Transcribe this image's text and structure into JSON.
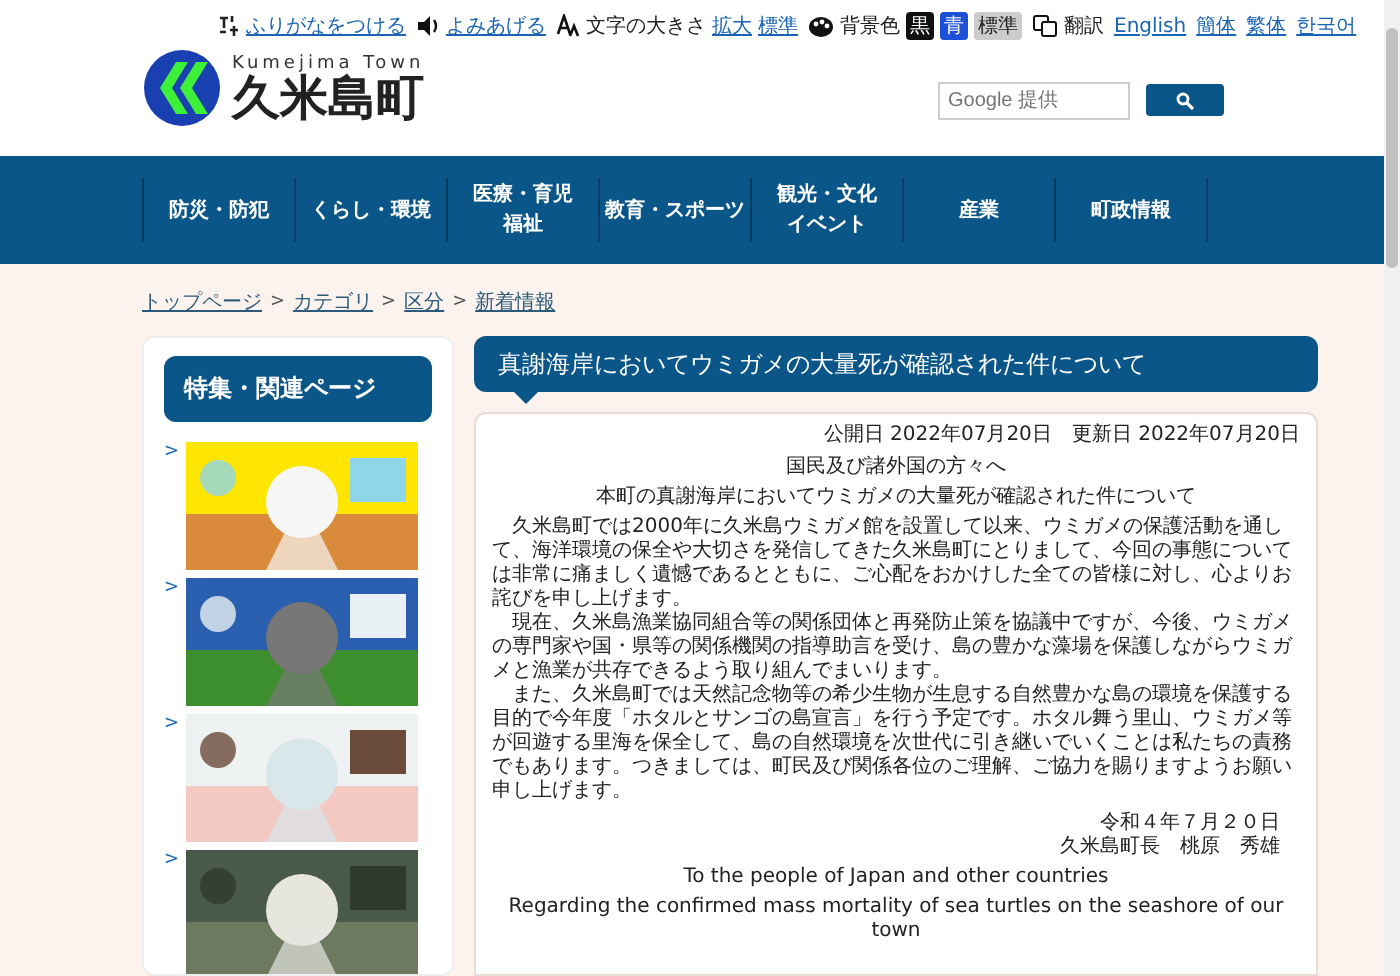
{
  "utility_bar": {
    "furigana": "ふりがなをつける",
    "read_aloud": "よみあげる",
    "text_size": {
      "label": "文字の大きさ",
      "links": [
        "拡大",
        "標準"
      ]
    },
    "background": {
      "label": "背景色",
      "options": [
        {
          "label": "黒",
          "kind": "black"
        },
        {
          "label": "青",
          "kind": "blue"
        },
        {
          "label": "標準",
          "kind": "standard"
        }
      ]
    },
    "translate": {
      "label": "翻訳",
      "links": [
        "English",
        "簡体",
        "繁体",
        "한국어"
      ]
    }
  },
  "logo": {
    "subtitle": "Kumejima Town",
    "title": "久米島町"
  },
  "search": {
    "placeholder": "Google 提供"
  },
  "nav": [
    {
      "lines": [
        "防災・防犯"
      ]
    },
    {
      "lines": [
        "くらし・環境"
      ]
    },
    {
      "lines": [
        "医療・育児",
        "福祉"
      ]
    },
    {
      "lines": [
        "教育・スポーツ"
      ]
    },
    {
      "lines": [
        "観光・文化",
        "イベント"
      ]
    },
    {
      "lines": [
        "産業"
      ]
    },
    {
      "lines": [
        "町政情報"
      ]
    }
  ],
  "breadcrumb": {
    "separator": ">",
    "items": [
      "トップページ",
      "カテゴリ",
      "区分",
      "新着情報"
    ]
  },
  "sidebar": {
    "title": "特集・関連ページ",
    "marker": ">"
  },
  "article": {
    "title": "真謝海岸においてウミガメの大量死が確認された件について",
    "dates": "公開日 2022年07月20日　更新日 2022年07月20日",
    "addressee": "国民及び諸外国の方々へ",
    "subject": "本町の真謝海岸においてウミガメの大量死が確認された件について",
    "paragraphs": [
      "久米島町では2000年に久米島ウミガメ館を設置して以来、ウミガメの保護活動を通して、海洋環境の保全や大切さを発信してきた久米島町にとりまして、今回の事態については非常に痛ましく遺憾であるとともに、ご心配をおかけした全ての皆様に対し、心よりお詫びを申し上げます。",
      "現在、久米島漁業協同組合等の関係団体と再発防止策を協議中ですが、今後、ウミガメの専門家や国・県等の関係機関の指導助言を受け、島の豊かな藻場を保護しながらウミガメと漁業が共存できるよう取り組んでまいります。",
      "また、久米島町では天然記念物等の希少生物が生息する自然豊かな島の環境を保護する目的で今年度「ホタルとサンゴの島宣言」を行う予定です。ホタル舞う里山、ウミガメ等が回遊する里海を保全して、島の自然環境を次世代に引き継いでいくことは私たちの責務でもあります。つきましては、町民及び関係各位のご理解、ご協力を賜りますようお願い申し上げます。"
    ],
    "signature": [
      "令和４年７月２０日",
      "久米島町長　桃原　秀雄"
    ],
    "english_title": "To the people of Japan and other countries",
    "english_lead": "Regarding the confirmed mass mortality of sea turtles on the seashore of our town"
  }
}
